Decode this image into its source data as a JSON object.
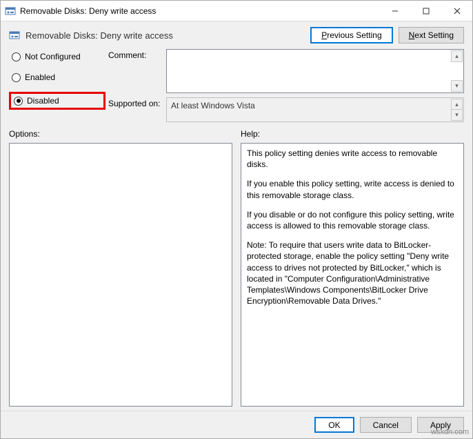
{
  "window": {
    "title": "Removable Disks: Deny write access"
  },
  "header": {
    "title": "Removable Disks: Deny write access",
    "prev_label_pre": "P",
    "prev_label_post": "revious Setting",
    "next_label_pre": "N",
    "next_label_post": "ext Setting"
  },
  "radios": {
    "not_configured": "Not Configured",
    "enabled": "Enabled",
    "disabled": "Disabled",
    "selected": "disabled"
  },
  "labels": {
    "comment": "Comment:",
    "supported": "Supported on:",
    "options": "Options:",
    "help": "Help:"
  },
  "supported_text": "At least Windows Vista",
  "help": {
    "p1": "This policy setting denies write access to removable disks.",
    "p2": "If you enable this policy setting, write access is denied to this removable storage class.",
    "p3": "If you disable or do not configure this policy setting, write access is allowed to this removable storage class.",
    "p4": "Note: To require that users write data to BitLocker-protected storage, enable the policy setting \"Deny write access to drives not protected by BitLocker,\" which is located in \"Computer Configuration\\Administrative Templates\\Windows Components\\BitLocker Drive Encryption\\Removable Data Drives.\""
  },
  "footer": {
    "ok": "OK",
    "cancel": "Cancel",
    "apply": "Apply"
  },
  "watermark": "wsxdn.com"
}
